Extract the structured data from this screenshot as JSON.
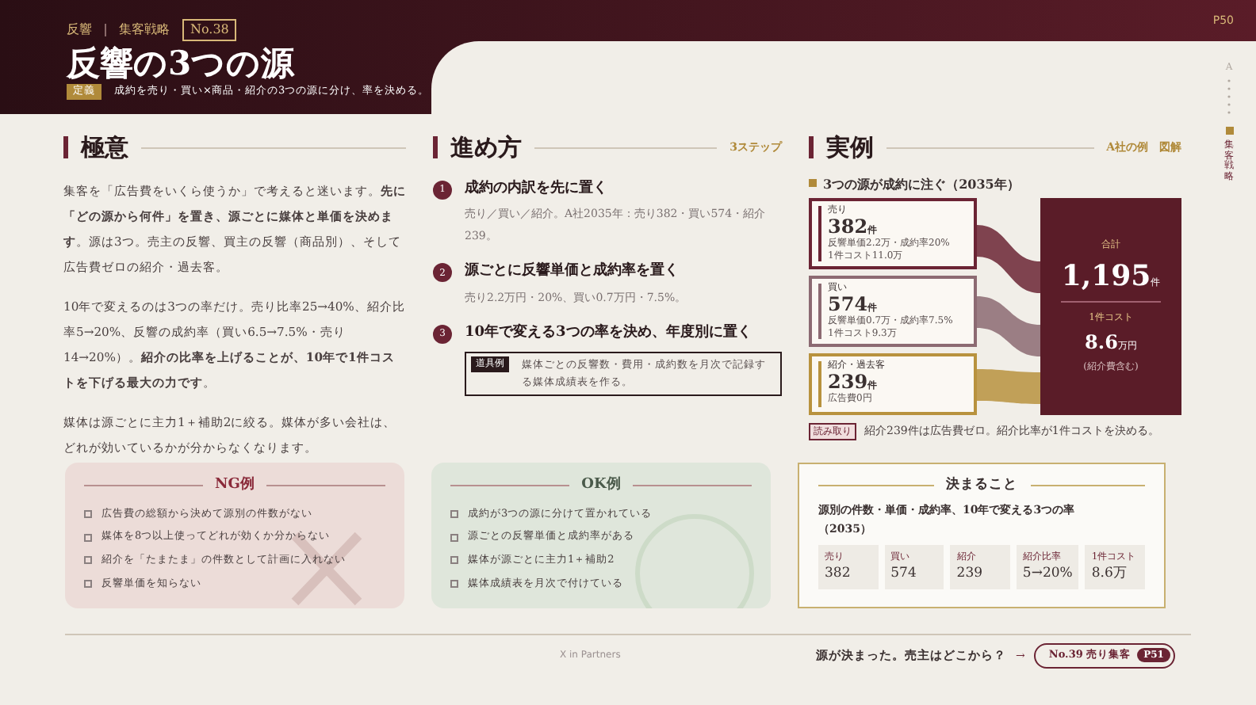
{
  "header": {
    "breadcrumb": [
      "反響",
      "集客戦略"
    ],
    "number": "No.38",
    "title": "反響の3つの源",
    "definition_label": "定義",
    "definition": "成約を売り・買い×商品・紹介の3つの源に分け、率を決める。",
    "page": "P50"
  },
  "side_nav": {
    "letter": "A",
    "label": "集客戦略"
  },
  "gist": {
    "heading": "極意",
    "paragraphs": [
      "集客を「広告費をいくら使うか」で考えると迷います。**先に「どの源から何件」を置き、源ごとに媒体と単価を決めます**。源は3つ。売主の反響、買主の反響（商品別）、そして広告費ゼロの紹介・過去客。",
      "10年で変えるのは3つの率だけ。売り比率25→40%、紹介比率5→20%、反響の成約率（買い6.5→7.5%・売り14→20%）。**紹介の比率を上げることが、10年で1件コストを下げる最大の力です**。",
      "媒体は源ごとに主力1＋補助2に絞る。媒体が多い会社は、どれが効いているかが分からなくなります。"
    ]
  },
  "steps": {
    "heading": "進め方",
    "note": "3ステップ",
    "items": [
      {
        "number": "1",
        "title": "成約の内訳を先に置く",
        "body": "売り／買い／紹介。A社2035年：売り382・買い574・紹介239。"
      },
      {
        "number": "2",
        "title": "源ごとに反響単価と成約率を置く",
        "body": "売り2.2万円・20%、買い0.7万円・7.5%。"
      },
      {
        "number": "3",
        "title": "10年で変える3つの率を決め、年度別に置く"
      }
    ],
    "tool_label": "道具例",
    "tool": "媒体ごとの反響数・費用・成約数を月次で記録する媒体成績表を作る。"
  },
  "example": {
    "heading": "実例",
    "note": "A社の例　図解",
    "subtitle": "3つの源が成約に注ぐ（2035年）",
    "sources": [
      {
        "name": "売り",
        "count": "382",
        "unit": "件",
        "details": [
          "反響単価2.2万・成約率20%",
          "1件コスト11.0万"
        ],
        "color": "#6b2434"
      },
      {
        "name": "買い",
        "count": "574",
        "unit": "件",
        "details": [
          "反響単価0.7万・成約率7.5%",
          "1件コスト9.3万"
        ],
        "color": "#8c6a72"
      },
      {
        "name": "紹介・過去客",
        "count": "239",
        "unit": "件",
        "details": [
          "広告費0円"
        ],
        "color": "#b8923e"
      }
    ],
    "total_label": "合計",
    "total": "1,195",
    "total_unit": "件",
    "cost_label": "1件コスト",
    "cost": "8.6",
    "cost_unit": "万円",
    "cost_note": "(紹介費含む)",
    "reading_label": "読み取り",
    "reading": "紹介239件は広告費ゼロ。紹介比率が1件コストを決める。"
  },
  "ng": {
    "title": "NG例",
    "items": [
      "広告費の総額から決めて源別の件数がない",
      "媒体を8つ以上使ってどれが効くか分からない",
      "紹介を「たまたま」の件数として計画に入れない",
      "反響単価を知らない"
    ]
  },
  "ok": {
    "title": "OK例",
    "items": [
      "成約が3つの源に分けて置かれている",
      "源ごとの反響単価と成約率がある",
      "媒体が源ごとに主力1＋補助2",
      "媒体成績表を月次で付けている"
    ]
  },
  "decide": {
    "title": "決まること",
    "text": "源別の件数・単価・成約率、10年で変える3つの率（2035）",
    "cells": [
      {
        "label": "売り",
        "value": "382"
      },
      {
        "label": "買い",
        "value": "574"
      },
      {
        "label": "紹介",
        "value": "239"
      },
      {
        "label": "紹介比率",
        "value": "5→20%"
      },
      {
        "label": "1件コスト",
        "value": "8.6万"
      }
    ]
  },
  "footer": {
    "brand": "X in Partners",
    "question": "源が決まった。売主はどこから？",
    "arrow": "→",
    "next": "No.39 売り集客",
    "next_page": "P51"
  }
}
